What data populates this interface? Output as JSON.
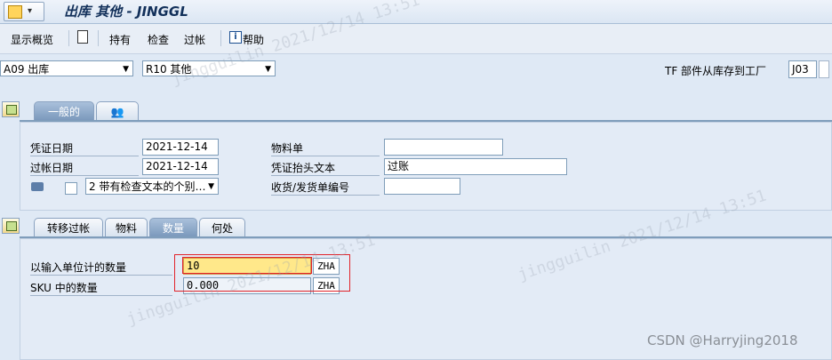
{
  "window": {
    "title": "出库 其他 - JINGGL"
  },
  "toolbar": {
    "show_overview": "显示概览",
    "hold": "持有",
    "check": "检查",
    "post": "过帐",
    "help": "帮助"
  },
  "selectors": {
    "movement_type": "A09 出库",
    "reference": "R10 其他",
    "tf_label": "TF 部件从库存到工厂",
    "plant_value": "J03"
  },
  "header_tabs": {
    "general": "一般的"
  },
  "header_fields": {
    "doc_date_label": "凭证日期",
    "doc_date_value": "2021-12-14",
    "post_date_label": "过帐日期",
    "post_date_value": "2021-12-14",
    "print_option": "2 带有检查文本的个别…",
    "material_slip_label": "物料单",
    "material_slip_value": "",
    "header_text_label": "凭证抬头文本",
    "header_text_value": "过账",
    "delivery_note_label": "收货/发货单编号",
    "delivery_note_value": ""
  },
  "item_tabs": [
    "转移过帐",
    "物料",
    "数量",
    "何处"
  ],
  "quantity": {
    "entry_unit_label": "以输入单位计的数量",
    "entry_unit_value": "10",
    "entry_unit_uom": "ZHA",
    "sku_label": "SKU 中的数量",
    "sku_value": "0.000",
    "sku_uom": "ZHA"
  },
  "watermark": "jingguilin 2021/12/14 13:51",
  "credit": "CSDN @Harryjing2018"
}
